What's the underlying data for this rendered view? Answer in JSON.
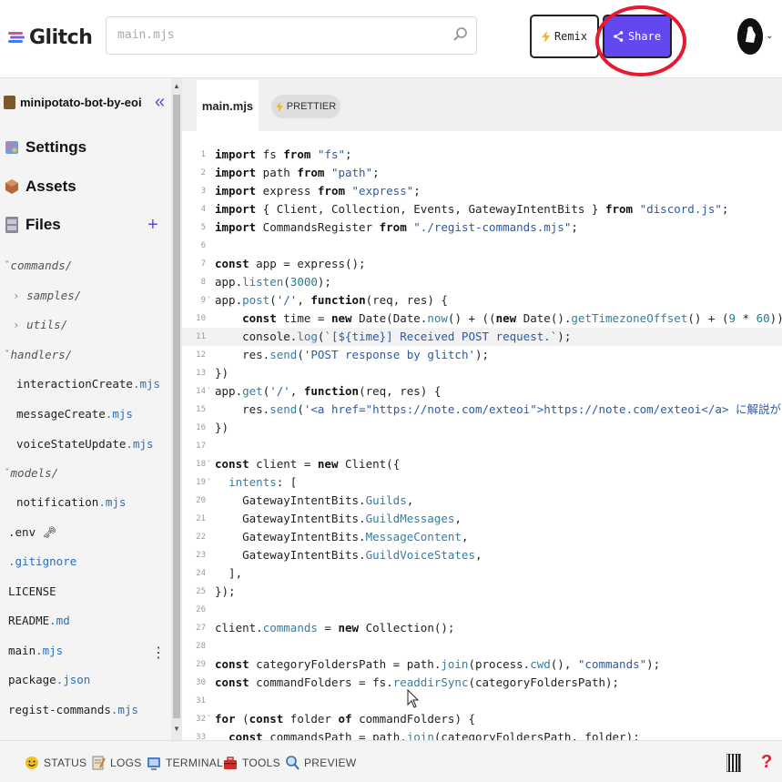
{
  "app": {
    "logo_text": "Glitch"
  },
  "search": {
    "value": "main.mjs"
  },
  "header": {
    "remix_label": "Remix",
    "share_label": "Share"
  },
  "sidebar": {
    "project_name": "minipotato-bot-by-eoi",
    "nav": [
      {
        "label": "Settings",
        "icon": "settings-icon"
      },
      {
        "label": "Assets",
        "icon": "assets-box-icon"
      },
      {
        "label": "Files",
        "icon": "files-cabinet-icon"
      }
    ],
    "tree": [
      {
        "name": "commands/",
        "ext": ""
      },
      {
        "name": "samples/",
        "ext": ""
      },
      {
        "name": "utils/",
        "ext": ""
      },
      {
        "name": "handlers/",
        "ext": ""
      },
      {
        "name": "interactionCreate",
        "ext": ".mjs"
      },
      {
        "name": "messageCreate",
        "ext": ".mjs"
      },
      {
        "name": "voiceStateUpdate",
        "ext": ".mjs"
      },
      {
        "name": "models/",
        "ext": ""
      },
      {
        "name": "notification",
        "ext": ".mjs"
      },
      {
        "name": ".env",
        "ext": ""
      },
      {
        "name": "",
        "ext": ".gitignore"
      },
      {
        "name": "LICENSE",
        "ext": ""
      },
      {
        "name": "README",
        "ext": ".md"
      },
      {
        "name": "main",
        "ext": ".mjs"
      },
      {
        "name": "package",
        "ext": ".json"
      },
      {
        "name": "regist-commands",
        "ext": ".mjs"
      }
    ]
  },
  "editor": {
    "tab_label": "main.mjs",
    "prettier_label": "PRETTIER",
    "line_numbers": [
      "1",
      "2",
      "3",
      "4",
      "5",
      "6",
      "7",
      "8",
      "9",
      "10",
      "11",
      "12",
      "13",
      "14",
      "15",
      "16",
      "17",
      "18",
      "19",
      "20",
      "21",
      "22",
      "23",
      "24",
      "25",
      "26",
      "27",
      "28",
      "29",
      "30",
      "31",
      "32",
      "33"
    ]
  },
  "bottombar": {
    "status": "STATUS",
    "logs": "LOGS",
    "terminal": "TERMINAL",
    "tools": "TOOLS",
    "preview": "PREVIEW",
    "help": "?"
  },
  "colors": {
    "share_bg": "#6148ef",
    "accent": "#5a4ad8",
    "annotation_circle": "#e8182e",
    "string": "#2a5aa8",
    "number": "#1c7f8c"
  }
}
